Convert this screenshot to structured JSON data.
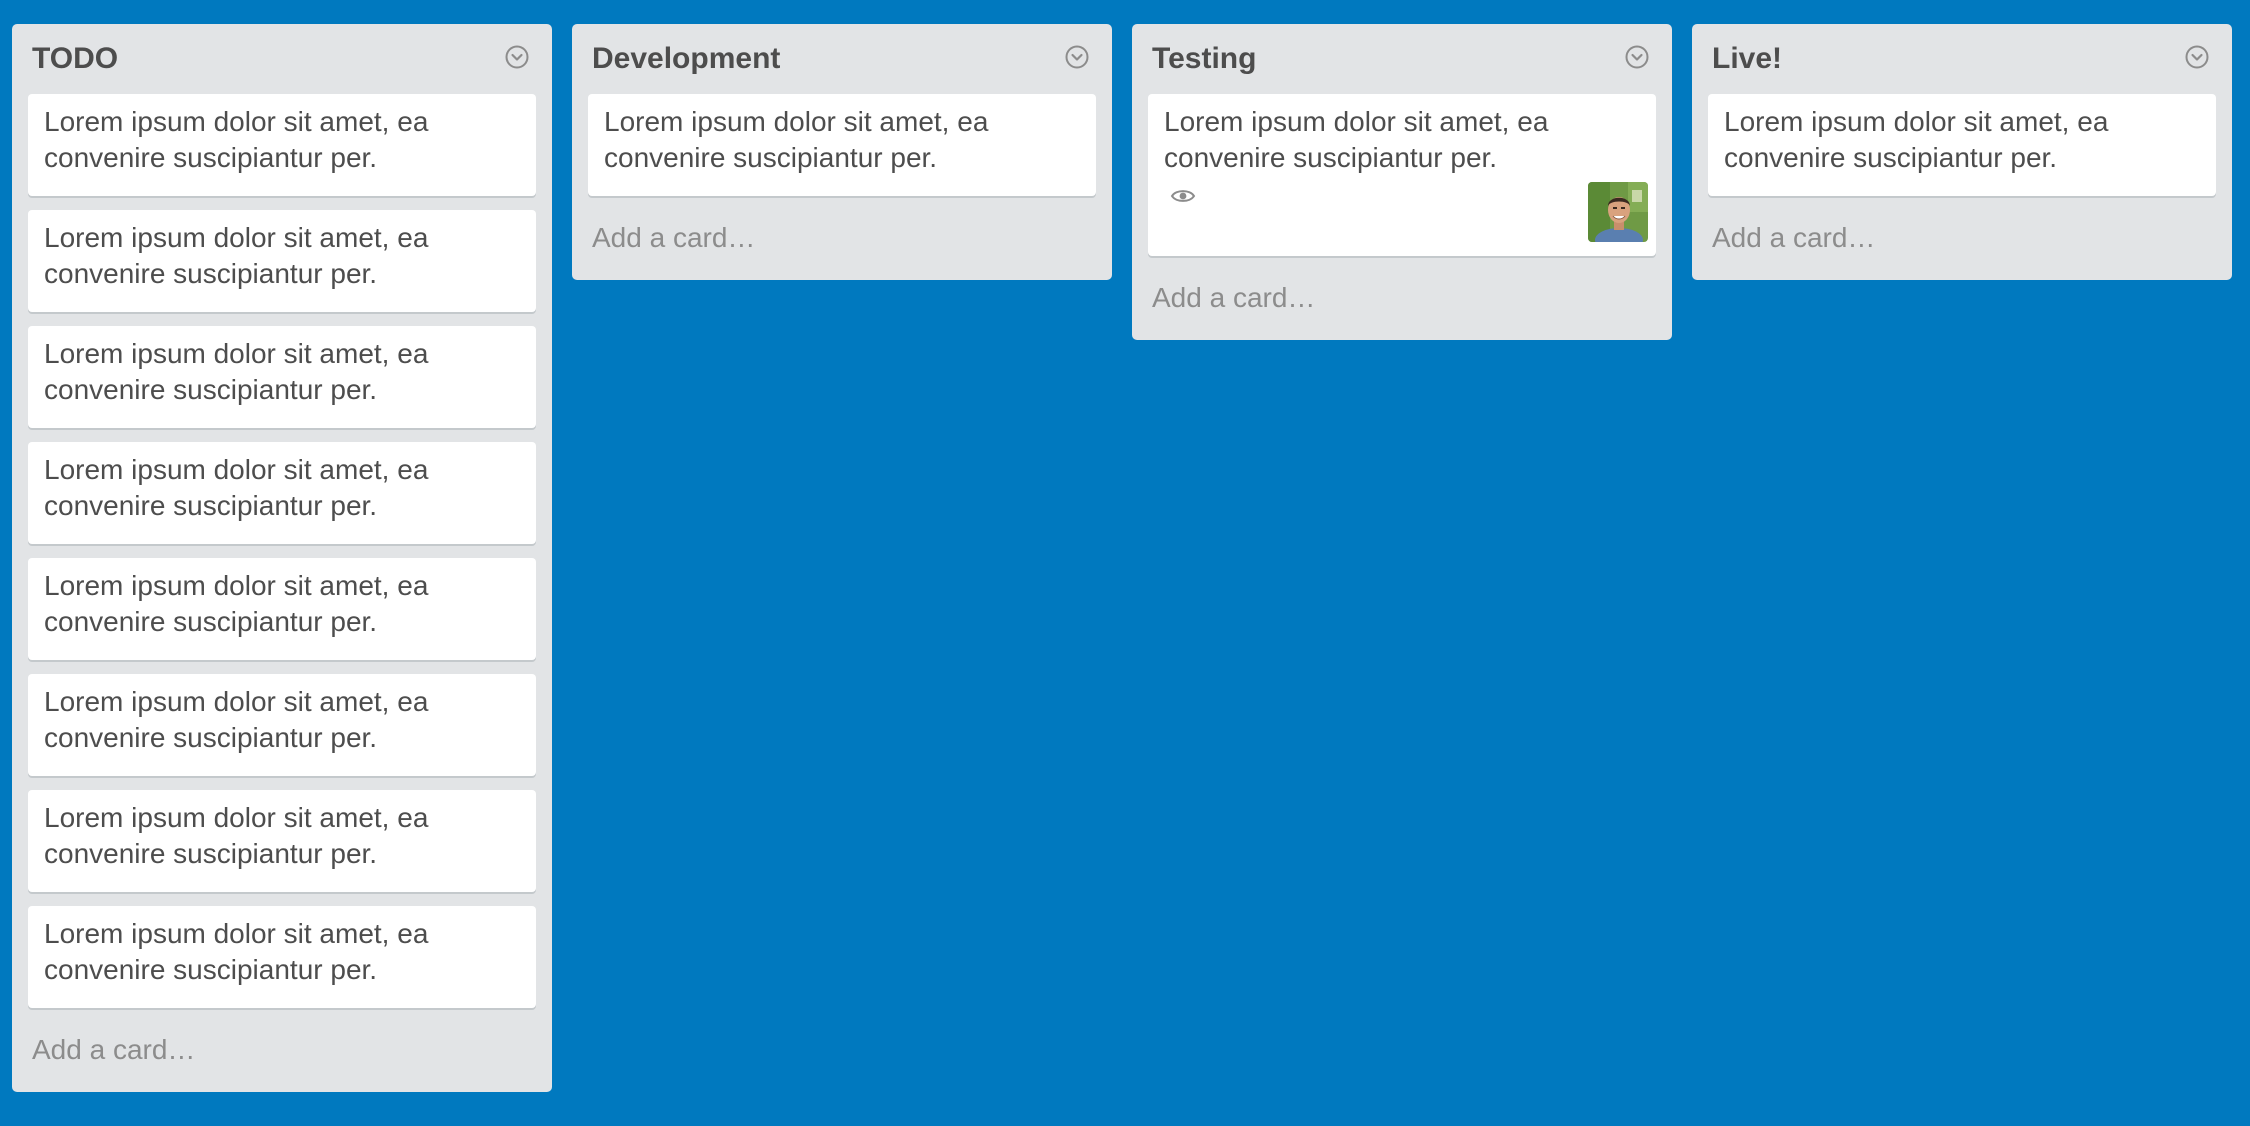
{
  "board": {
    "lists": [
      {
        "title": "TODO",
        "cards": [
          {
            "text": "Lorem ipsum dolor sit amet, ea convenire suscipiantur per."
          },
          {
            "text": "Lorem ipsum dolor sit amet, ea convenire suscipiantur per."
          },
          {
            "text": "Lorem ipsum dolor sit amet, ea convenire suscipiantur per."
          },
          {
            "text": "Lorem ipsum dolor sit amet, ea convenire suscipiantur per."
          },
          {
            "text": "Lorem ipsum dolor sit amet, ea convenire suscipiantur per."
          },
          {
            "text": "Lorem ipsum dolor sit amet, ea convenire suscipiantur per."
          },
          {
            "text": "Lorem ipsum dolor sit amet, ea convenire suscipiantur per."
          },
          {
            "text": "Lorem ipsum dolor sit amet, ea convenire suscipiantur per."
          }
        ],
        "add_card_label": "Add a card…"
      },
      {
        "title": "Development",
        "cards": [
          {
            "text": "Lorem ipsum dolor sit amet, ea convenire suscipiantur per."
          }
        ],
        "add_card_label": "Add a card…"
      },
      {
        "title": "Testing",
        "cards": [
          {
            "text": "Lorem ipsum dolor sit amet, ea convenire suscipiantur per.",
            "badges": [
              "eye-icon"
            ],
            "members": [
              "avatar"
            ]
          }
        ],
        "add_card_label": "Add a card…"
      },
      {
        "title": "Live!",
        "cards": [
          {
            "text": "Lorem ipsum dolor sit amet, ea convenire suscipiantur per."
          }
        ],
        "add_card_label": "Add a card…"
      }
    ]
  },
  "colors": {
    "board_background": "#0079bf",
    "list_background": "#e2e4e6",
    "card_background": "#ffffff",
    "text": "#4d4d4d",
    "muted_text": "#8c8c8c"
  }
}
